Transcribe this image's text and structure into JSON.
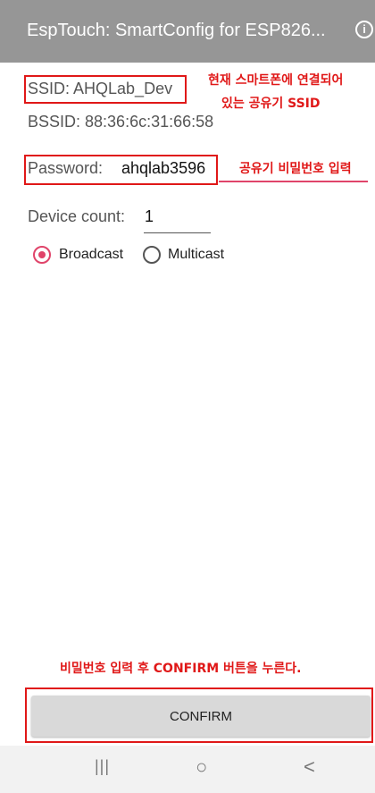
{
  "appbar": {
    "title": "EspTouch: SmartConfig for ESP826...",
    "info_icon": "i"
  },
  "wifi": {
    "ssid": "SSID: AHQLab_Dev",
    "bssid": "BSSID: 88:36:6c:31:66:58"
  },
  "password": {
    "label": "Password:",
    "value": "ahqlab3596"
  },
  "device": {
    "label": "Device count:",
    "value": "1"
  },
  "mode": {
    "broadcast": "Broadcast",
    "multicast": "Multicast",
    "selected": "Broadcast"
  },
  "annotations": {
    "ssid_line1": "현재 스마트폰에 연결되어",
    "ssid_line2": "있는 공유기 SSID",
    "password": "공유기 비밀번호 입력",
    "confirm": "비밀번호 입력 후 CONFIRM 버튼을 누른다."
  },
  "confirm_label": "CONFIRM",
  "nav": {
    "recents": "|||",
    "home": "○",
    "back": "<"
  },
  "colors": {
    "appbar": "#969696",
    "accent": "#e0446a",
    "annotation": "#e01818"
  }
}
